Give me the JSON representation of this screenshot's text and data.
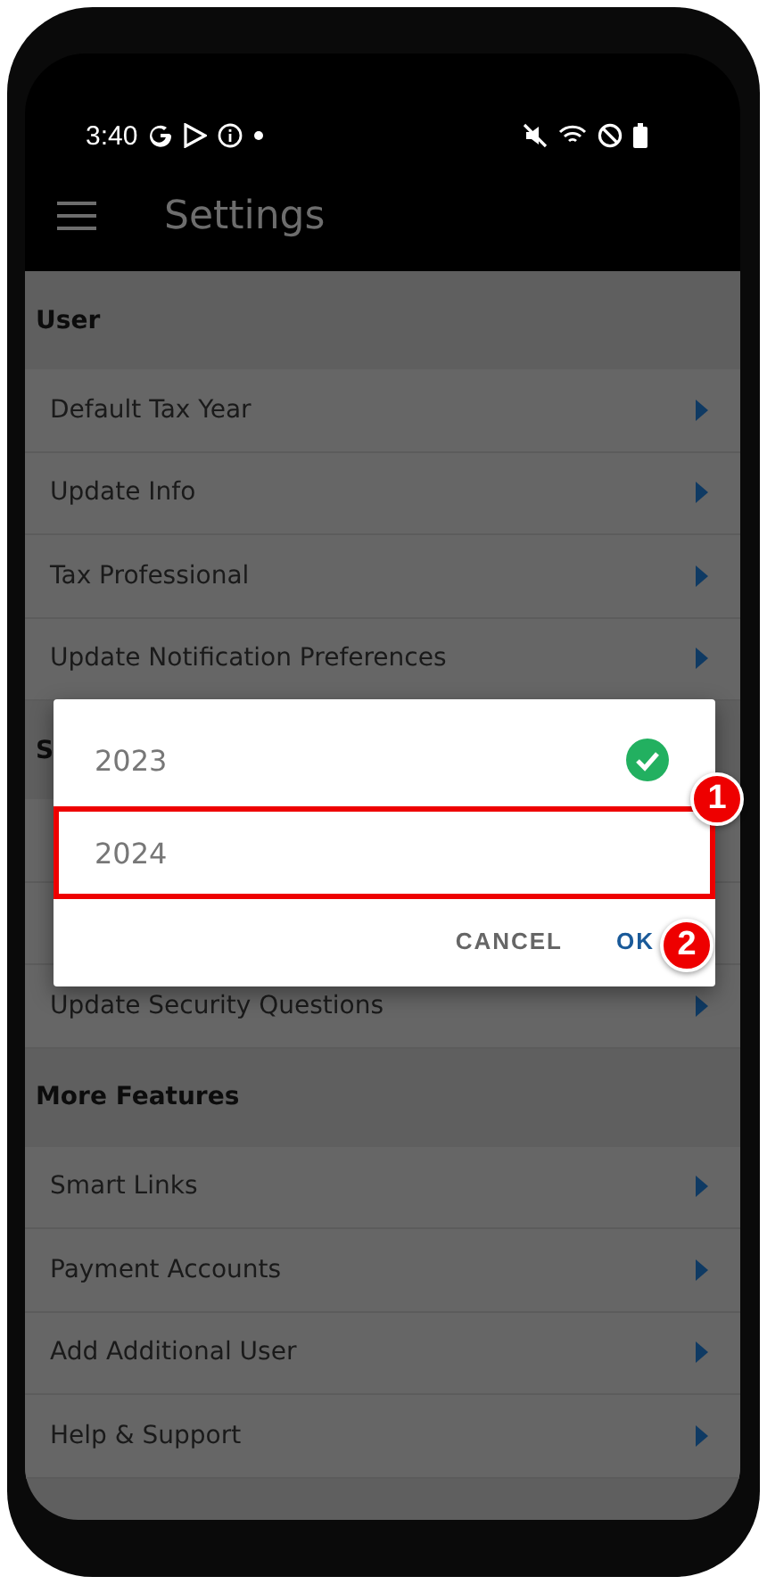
{
  "status_bar": {
    "time": "3:40"
  },
  "app_bar": {
    "title": "Settings"
  },
  "sections": [
    {
      "title": "User",
      "rows": [
        {
          "label": "Default Tax Year"
        },
        {
          "label": "Update Info"
        },
        {
          "label": "Tax Professional"
        },
        {
          "label": "Update Notification Preferences"
        }
      ]
    },
    {
      "title": "S",
      "rows": [
        {
          "kind": "covered"
        },
        {
          "kind": "covered"
        },
        {
          "kind": "item",
          "label": "Update Security Questions"
        }
      ]
    },
    {
      "title": "More Features",
      "rows": [
        {
          "label": "Smart Links"
        },
        {
          "label": "Payment Accounts"
        },
        {
          "label": "Add Additional User"
        },
        {
          "label": "Help & Support"
        }
      ]
    }
  ],
  "dialog": {
    "options": [
      {
        "label": "2023",
        "selected": true,
        "highlighted": false
      },
      {
        "label": "2024",
        "selected": false,
        "highlighted": true
      }
    ],
    "cancel": "CANCEL",
    "ok": "OK",
    "badges": [
      "1",
      "2"
    ]
  }
}
